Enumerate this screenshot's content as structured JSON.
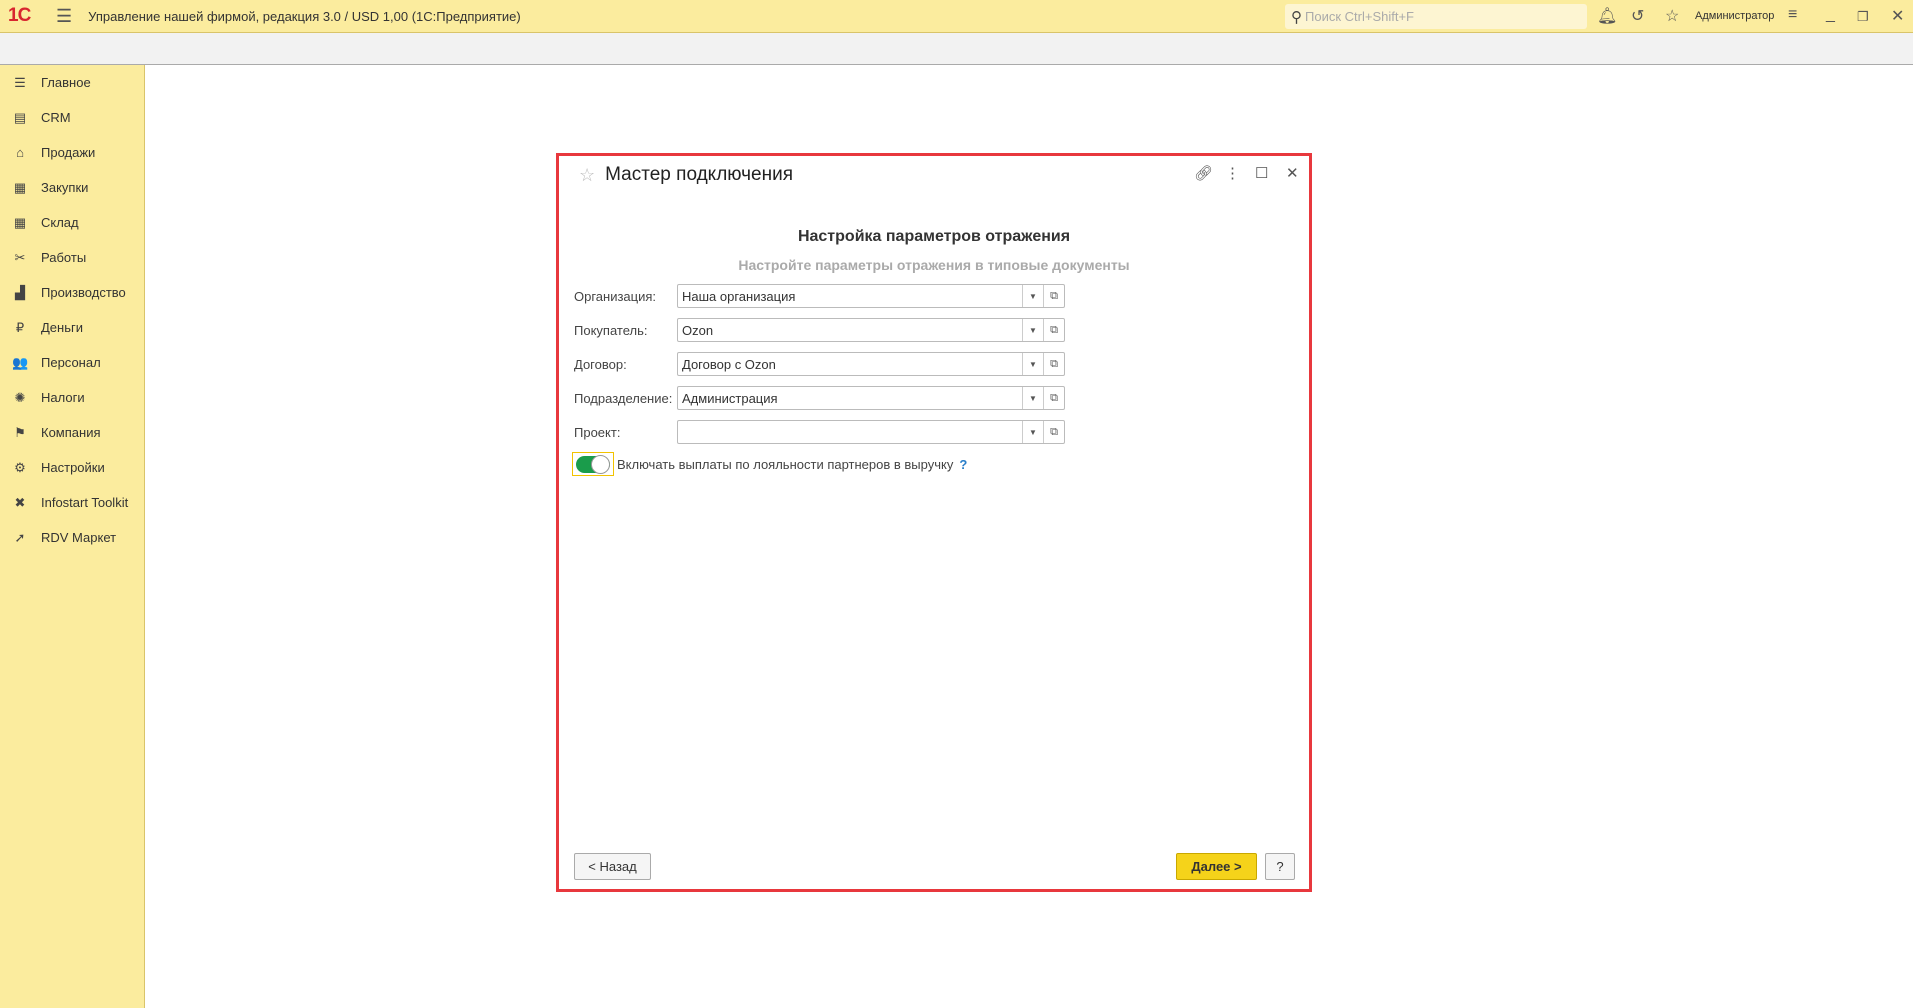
{
  "topbar": {
    "logo": "1С",
    "title": "Управление нашей фирмой, редакция 3.0 / USD 1,00  (1С:Предприятие)",
    "search_placeholder": "Поиск Ctrl+Shift+F",
    "user": "Администратор"
  },
  "sidebar": {
    "items": [
      {
        "label": "Главное",
        "icon": "☰"
      },
      {
        "label": "CRM",
        "icon": "▤"
      },
      {
        "label": "Продажи",
        "icon": "⌂"
      },
      {
        "label": "Закупки",
        "icon": "▦"
      },
      {
        "label": "Склад",
        "icon": "▦"
      },
      {
        "label": "Работы",
        "icon": "✂"
      },
      {
        "label": "Производство",
        "icon": "▟"
      },
      {
        "label": "Деньги",
        "icon": "₽"
      },
      {
        "label": "Персонал",
        "icon": "👥"
      },
      {
        "label": "Налоги",
        "icon": "✺"
      },
      {
        "label": "Компания",
        "icon": "⚑"
      },
      {
        "label": "Настройки",
        "icon": "⚙"
      },
      {
        "label": "Infostart Toolkit",
        "icon": "✖"
      },
      {
        "label": "RDV Маркет",
        "icon": "➚"
      }
    ]
  },
  "dialog": {
    "title": "Мастер подключения",
    "heading": "Настройка параметров отражения",
    "subheading": "Настройте параметры отражения в типовые документы",
    "fields": [
      {
        "label": "Организация:",
        "value": "Наша организация"
      },
      {
        "label": "Покупатель:",
        "value": "Ozon"
      },
      {
        "label": "Договор:",
        "value": "Договор с Ozon"
      },
      {
        "label": "Подразделение:",
        "value": "Администрация"
      },
      {
        "label": "Проект:",
        "value": ""
      }
    ],
    "toggle": {
      "label": "Включать выплаты по лояльности партнеров в выручку",
      "checked": true,
      "help": "?"
    },
    "back_label": "< Назад",
    "next_label": "Далее >",
    "help_label": "?"
  }
}
